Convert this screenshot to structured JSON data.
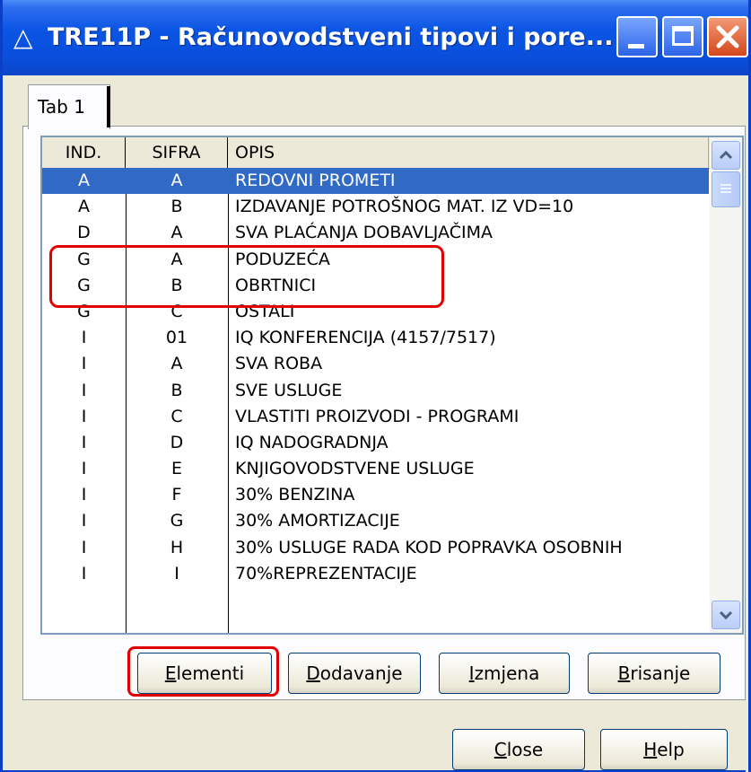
{
  "window": {
    "title": "TRE11P - Računovodstveni tipovi i pore...",
    "title_icon": "triangle-icon"
  },
  "tabs": [
    {
      "label": "Tab 1"
    }
  ],
  "grid": {
    "columns": [
      "IND.",
      "SIFRA",
      "OPIS"
    ],
    "rows": [
      {
        "ind": "A",
        "sifra": "A",
        "opis": "REDOVNI PROMETI",
        "selected": true
      },
      {
        "ind": "A",
        "sifra": "B",
        "opis": "IZDAVANJE POTROŠNOG MAT. IZ VD=10"
      },
      {
        "ind": "D",
        "sifra": "A",
        "opis": "SVA PLAĆANJA DOBAVLJAČIMA"
      },
      {
        "ind": "G",
        "sifra": "A",
        "opis": "PODUZEĆA",
        "highlighted": true
      },
      {
        "ind": "G",
        "sifra": "B",
        "opis": "OBRTNICI",
        "highlighted": true
      },
      {
        "ind": "G",
        "sifra": "C",
        "opis": "OSTALI"
      },
      {
        "ind": "I",
        "sifra": "01",
        "opis": "IQ KONFERENCIJA (4157/7517)"
      },
      {
        "ind": "I",
        "sifra": "A",
        "opis": "SVA ROBA"
      },
      {
        "ind": "I",
        "sifra": "B",
        "opis": "SVE USLUGE"
      },
      {
        "ind": "I",
        "sifra": "C",
        "opis": "VLASTITI PROIZVODI - PROGRAMI"
      },
      {
        "ind": "I",
        "sifra": "D",
        "opis": "IQ NADOGRADNJA"
      },
      {
        "ind": "I",
        "sifra": "E",
        "opis": "KNJIGOVODSTVENE USLUGE"
      },
      {
        "ind": "I",
        "sifra": "F",
        "opis": "30% BENZINA"
      },
      {
        "ind": "I",
        "sifra": "G",
        "opis": "30% AMORTIZACIJE"
      },
      {
        "ind": "I",
        "sifra": "H",
        "opis": "30% USLUGE RADA KOD POPRAVKA OSOBNIH"
      },
      {
        "ind": "I",
        "sifra": "I",
        "opis": "70%REPREZENTACIJE"
      }
    ]
  },
  "buttons": {
    "elementi": {
      "accel": "E",
      "rest": "lementi",
      "highlighted": true
    },
    "dodavanje": {
      "accel": "D",
      "rest": "odavanje"
    },
    "izmjena": {
      "accel": "I",
      "rest": "zmjena"
    },
    "brisanje": {
      "accel": "B",
      "rest": "risanje"
    },
    "close": {
      "accel": "C",
      "rest": "lose"
    },
    "help": {
      "accel": "H",
      "rest": "elp"
    }
  },
  "colors": {
    "selection": "#316ac5",
    "annotation": "#e00000",
    "titlebar": "#0a4fdc"
  }
}
